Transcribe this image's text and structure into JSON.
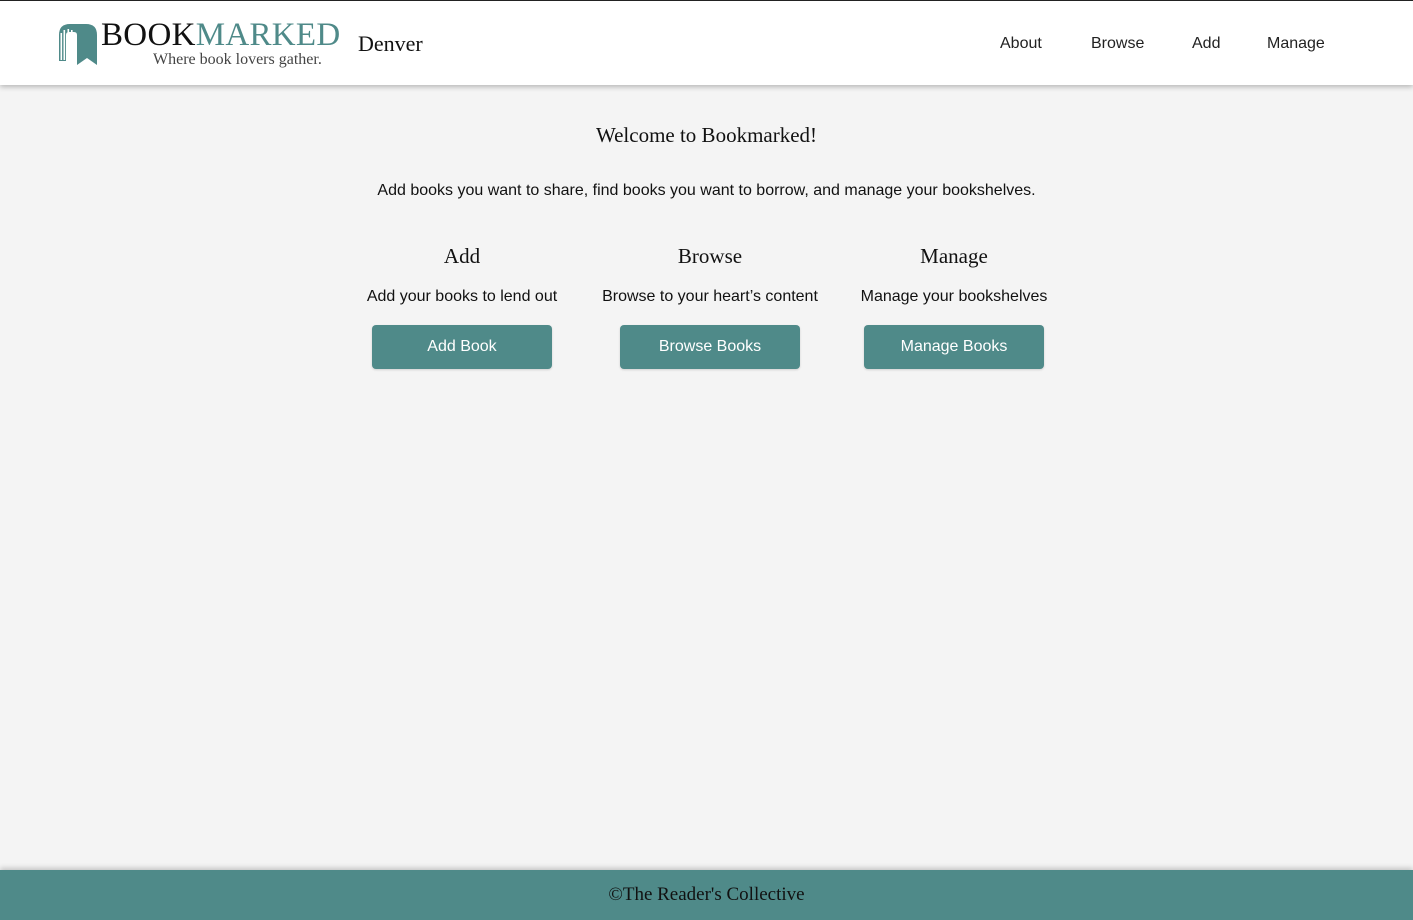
{
  "brand": {
    "name_part1": "BOOK",
    "name_part2": "MARKED",
    "tagline": "Where book lovers gather.",
    "logo_icon": "book-spine-bookmark-icon",
    "accent_color": "#4f8a89"
  },
  "header": {
    "city": "Denver"
  },
  "nav": {
    "items": [
      {
        "label": "About"
      },
      {
        "label": "Browse"
      },
      {
        "label": "Add"
      },
      {
        "label": "Manage"
      }
    ]
  },
  "main": {
    "title": "Welcome to Bookmarked!",
    "intro": "Add books you want to share, find books you want to borrow, and manage your bookshelves.",
    "cards": [
      {
        "heading": "Add",
        "description": "Add your books to lend out",
        "button_label": "Add Book"
      },
      {
        "heading": "Browse",
        "description": "Browse to your heart’s content",
        "button_label": "Browse Books"
      },
      {
        "heading": "Manage",
        "description": "Manage your bookshelves",
        "button_label": "Manage Books"
      }
    ]
  },
  "footer": {
    "copyright": "©The Reader's Collective"
  },
  "colors": {
    "background": "#f4f4f4",
    "header_background": "#ffffff",
    "button_background": "#4f8a89",
    "footer_background": "#4f8a89"
  }
}
